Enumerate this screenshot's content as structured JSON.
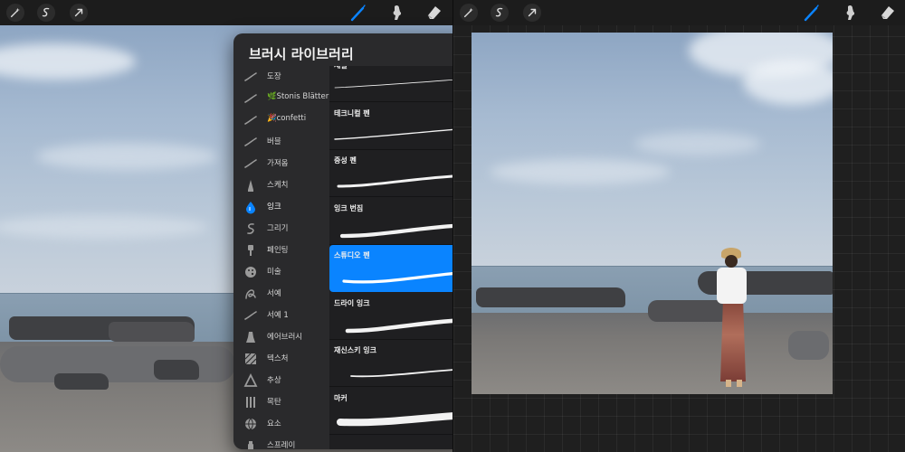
{
  "toolbar": {
    "left_icons": [
      "wand-icon",
      "selection-icon",
      "move-arrow-icon"
    ],
    "right_icons": [
      "brush-tool-icon",
      "smudge-tool-icon",
      "eraser-tool-icon"
    ],
    "active_tool": "brush",
    "active_color": "#0a84ff"
  },
  "brush_library": {
    "title": "브러시 라이브러리",
    "categories": [
      {
        "label": "도장",
        "icon": "stroke-icon"
      },
      {
        "label": "🌿Stonis Blätter",
        "icon": "stroke-icon"
      },
      {
        "label": "🎉confetti",
        "icon": "stroke-icon"
      },
      {
        "label": "버블",
        "icon": "stroke-icon"
      },
      {
        "label": "가져옴",
        "icon": "stroke-icon"
      },
      {
        "label": "스케치",
        "icon": "pencil-tip-icon"
      },
      {
        "label": "잉크",
        "icon": "ink-drop-icon",
        "active": true
      },
      {
        "label": "그리기",
        "icon": "swirl-icon"
      },
      {
        "label": "페인팅",
        "icon": "paintbrush-icon"
      },
      {
        "label": "미술",
        "icon": "palette-icon"
      },
      {
        "label": "서예",
        "icon": "calligraphy-icon"
      },
      {
        "label": "서예 1",
        "icon": "stroke-icon"
      },
      {
        "label": "에어브러시",
        "icon": "airbrush-icon"
      },
      {
        "label": "텍스처",
        "icon": "texture-icon"
      },
      {
        "label": "추상",
        "icon": "triangle-icon"
      },
      {
        "label": "목탄",
        "icon": "charcoal-icon"
      },
      {
        "label": "요소",
        "icon": "globe-icon"
      },
      {
        "label": "스프레이",
        "icon": "spray-icon"
      }
    ],
    "brushes": [
      {
        "name": "세필",
        "stroke": "thin"
      },
      {
        "name": "테크니컬 펜",
        "stroke": "technical"
      },
      {
        "name": "중성 펜",
        "stroke": "gel"
      },
      {
        "name": "잉크 번짐",
        "stroke": "bleed"
      },
      {
        "name": "스튜디오 펜",
        "stroke": "studio",
        "selected": true
      },
      {
        "name": "드라이 잉크",
        "stroke": "dry"
      },
      {
        "name": "재신스키 잉크",
        "stroke": "syrup"
      },
      {
        "name": "마커",
        "stroke": "marker"
      }
    ]
  },
  "colors": {
    "accent": "#0a84ff",
    "panel_bg": "#2a2a2c",
    "list_bg": "#1f1f21",
    "toolbar_bg": "#1c1c1c"
  }
}
